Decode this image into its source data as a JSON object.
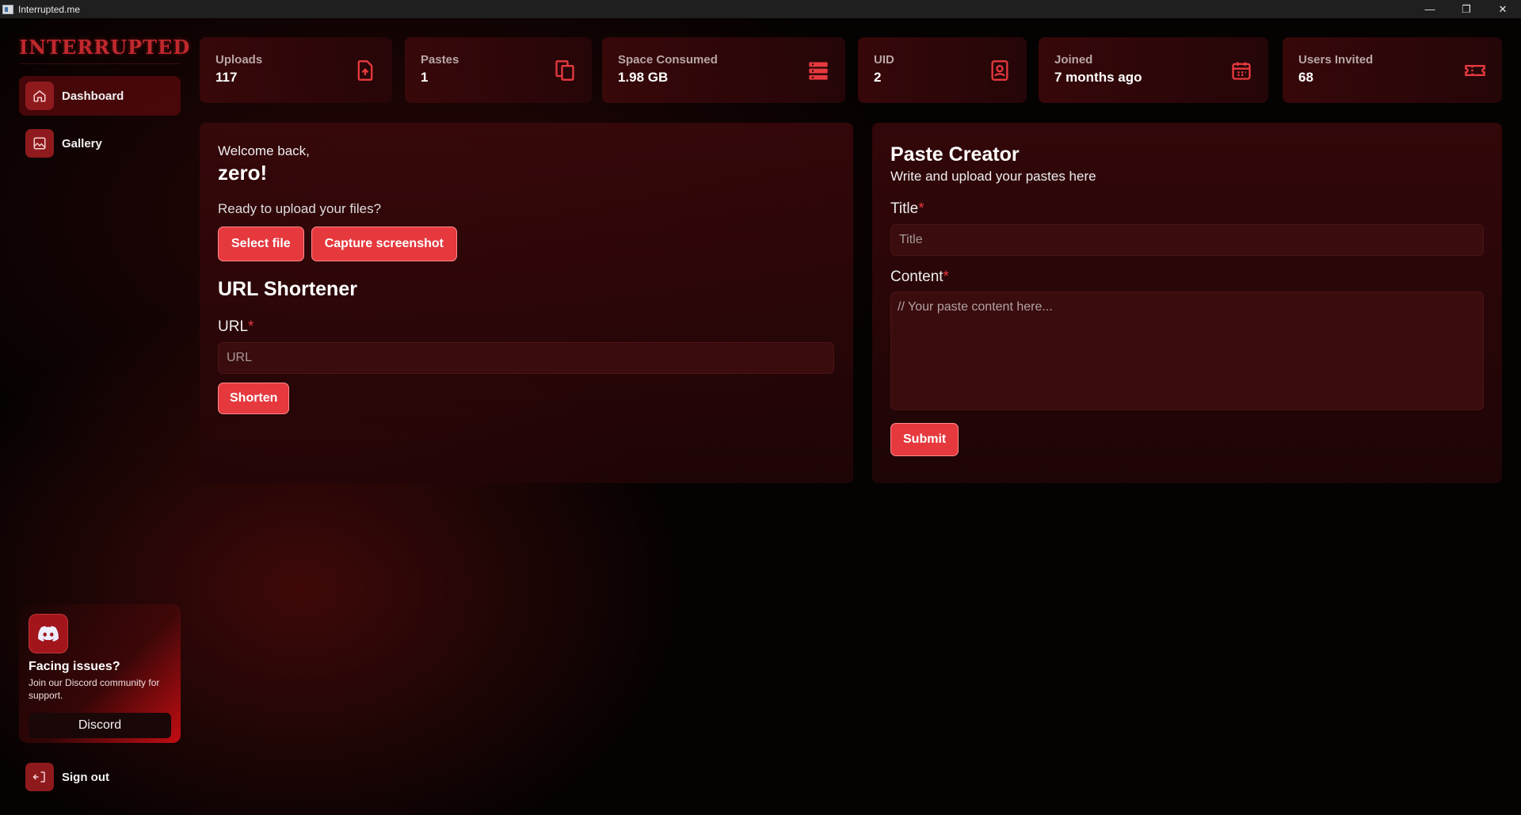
{
  "window": {
    "title": "Interrupted.me",
    "controls": [
      "minimize",
      "restore",
      "close"
    ]
  },
  "sidebar": {
    "logo": "INTERRUPTED",
    "items": [
      {
        "label": "Dashboard",
        "icon": "home-icon",
        "active": true
      },
      {
        "label": "Gallery",
        "icon": "image-icon",
        "active": false
      }
    ],
    "support": {
      "title": "Facing issues?",
      "text": "Join our Discord community for support.",
      "button": "Discord"
    },
    "signout": "Sign out"
  },
  "stats": [
    {
      "label": "Uploads",
      "value": "117",
      "icon": "file-upload-icon"
    },
    {
      "label": "Pastes",
      "value": "1",
      "icon": "clipboard-icon"
    },
    {
      "label": "Space Consumed",
      "value": "1.98 GB",
      "icon": "server-icon"
    },
    {
      "label": "UID",
      "value": "2",
      "icon": "id-badge-icon"
    },
    {
      "label": "Joined",
      "value": "7 months ago",
      "icon": "calendar-icon"
    },
    {
      "label": "Users Invited",
      "value": "68",
      "icon": "ticket-icon"
    }
  ],
  "welcome": {
    "greeting": "Welcome back,",
    "name": "zero!",
    "prompt": "Ready to upload your files?",
    "select_file": "Select file",
    "capture_screenshot": "Capture screenshot"
  },
  "shortener": {
    "title": "URL Shortener",
    "url_label": "URL",
    "url_placeholder": "URL",
    "button": "Shorten"
  },
  "paste": {
    "title": "Paste Creator",
    "subtitle": "Write and upload your pastes here",
    "title_label": "Title",
    "title_placeholder": "Title",
    "content_label": "Content",
    "content_placeholder": "// Your paste content here...",
    "submit": "Submit"
  },
  "colors": {
    "accent": "#e5393e",
    "accent_dark": "#8e1a1e",
    "background": "#050202"
  }
}
